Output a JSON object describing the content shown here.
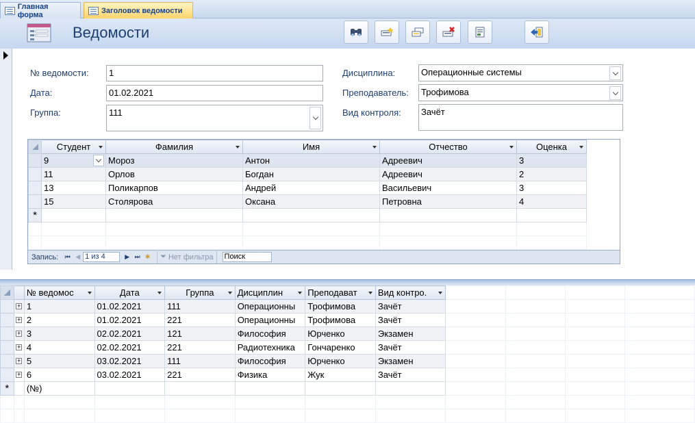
{
  "tabs": [
    {
      "label": "Главная форма"
    },
    {
      "label": "Заголовок ведомости"
    }
  ],
  "header": {
    "title": "Ведомости"
  },
  "form": {
    "number_label": "№ ведомости:",
    "number_value": "1",
    "date_label": "Дата:",
    "date_value": "01.02.2021",
    "group_label": "Группа:",
    "group_value": "111",
    "discipline_label": "Дисциплина:",
    "discipline_value": "Операционные системы",
    "teacher_label": "Преподаватель:",
    "teacher_value": "Трофимова",
    "control_label": "Вид контроля:",
    "control_value": "Зачёт"
  },
  "subform": {
    "columns": [
      "Студент",
      "Фамилия",
      "Имя",
      "Отчество",
      "Оценка"
    ],
    "rows": [
      [
        "9",
        "Мороз",
        "Антон",
        "Адреевич",
        "3"
      ],
      [
        "11",
        "Орлов",
        "Богдан",
        "Адреевич",
        "2"
      ],
      [
        "13",
        "Поликарпов",
        "Андрей",
        "Васильевич",
        "3"
      ],
      [
        "15",
        "Столярова",
        "Оксана",
        "Петровна",
        "4"
      ]
    ],
    "nav": {
      "record_label": "Запись:",
      "position": "1 из 4",
      "filter_label": "Нет фильтра",
      "search_placeholder": "Поиск"
    }
  },
  "datasheet": {
    "columns": [
      "№ ведомос",
      "Дата",
      "Группа",
      "Дисциплин",
      "Преподават",
      "Вид контро."
    ],
    "rows": [
      [
        "1",
        "01.02.2021",
        "111",
        "Операционны",
        "Трофимова",
        "Зачёт"
      ],
      [
        "2",
        "01.02.2021",
        "221",
        "Операционны",
        "Трофимова",
        "Зачёт"
      ],
      [
        "3",
        "02.02.2021",
        "121",
        "Философия",
        "Юрченко",
        "Экзамен"
      ],
      [
        "4",
        "02.02.2021",
        "221",
        "Радиотехника",
        "Гончаренко",
        "Зачёт"
      ],
      [
        "5",
        "03.02.2021",
        "111",
        "Философия",
        "Юрченко",
        "Экзамен"
      ],
      [
        "6",
        "03.02.2021",
        "221",
        "Физика",
        "Жук",
        "Зачёт"
      ]
    ],
    "new_row_placeholder": "(№)"
  },
  "colors": {
    "accent": "#1e3e72",
    "tab_active": "#ffd36b",
    "header_band": "#c6d8ef"
  }
}
